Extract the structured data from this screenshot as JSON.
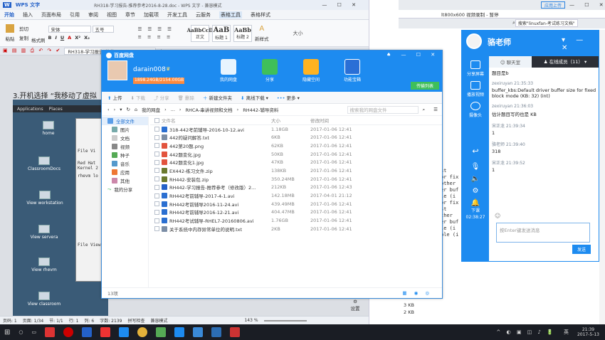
{
  "wps": {
    "app": "WPS 文字",
    "doc_title": "RH318-学习报告-推荐参考2016-8-28.doc - WPS 文字 - 兼容模式",
    "menu": [
      "开始",
      "插入",
      "页面布局",
      "引用",
      "审阅",
      "视图",
      "章节",
      "加载项",
      "开发工具",
      "云服务",
      "表格工具",
      "表格样式"
    ],
    "ribbon": {
      "clipboard": [
        "剪切",
        "复制",
        "格式刷"
      ],
      "paste": "粘贴",
      "font": "宋体",
      "size": "五号",
      "styles": [
        {
          "preview": "AaBbCcD",
          "name": "正文"
        },
        {
          "preview": "AaB",
          "name": "标题 1"
        },
        {
          "preview": "AaBb",
          "name": "标题 2"
        }
      ],
      "new_style": "新样式",
      "big": "大小"
    },
    "tab": "RH318-学习报告-推荐...2016-8-28.doc",
    "doc_line": "3.开机选择 “我移动了虚拟",
    "status": [
      "页码: 1",
      "页面: 1/34",
      "节: 1/1",
      "行: 1",
      "列: 6",
      "字数: 2139",
      "拼写检查",
      "兼容模式"
    ],
    "zoom": "143 %"
  },
  "vm": {
    "bar": [
      "Applications",
      "Places"
    ],
    "icons": [
      "home",
      "ClassroomDocs",
      "View workstation",
      "View servera",
      "View rhevm",
      "View classroom"
    ],
    "term_lines": [
      "File  Vi",
      "Red Hat",
      "Kernel 2",
      "rhevm lo",
      "File  View"
    ]
  },
  "terminal_right": [
    "st",
    "or fix",
    "other",
    "er buf",
    "le (i",
    "or fix",
    "st",
    "ther",
    "er buf",
    "le (i",
    "ble (i"
  ],
  "baidu": {
    "title": "百度网盘",
    "user": "darain008",
    "quota": "1898.24GB/2154.00GB",
    "nav": [
      "我的网盘",
      "分享",
      "隐藏空间",
      "功能宝箱"
    ],
    "transfer": "传输列表",
    "toolbar": [
      "上传",
      "下载",
      "分享",
      "删除",
      "新建文件夹",
      "离线下载",
      "更多"
    ],
    "path": [
      "我的网盘",
      "...",
      "RHCA-串讲视频和文档",
      "RH442-辅导资料"
    ],
    "search_placeholder": "搜索我的网盘文件",
    "side": [
      "全部文件",
      "图片",
      "文档",
      "视频",
      "种子",
      "音乐",
      "应用",
      "其他",
      "我的分享"
    ],
    "cols": [
      "文件名",
      "大小",
      "修改时间"
    ],
    "files": [
      {
        "name": "318-442考前辅导-2016-10-12.avi",
        "size": "1.18GB",
        "time": "2017-01-06 12:41",
        "type": "video"
      },
      {
        "name": "442的疑问解答.txt",
        "size": "6KB",
        "time": "2017-01-06 12:41",
        "type": "txt"
      },
      {
        "name": "442第20题.png",
        "size": "62KB",
        "time": "2017-01-06 12:41",
        "type": "img"
      },
      {
        "name": "442题变化.jpg",
        "size": "50KB",
        "time": "2017-01-06 12:41",
        "type": "img"
      },
      {
        "name": "442题变化1.jpg",
        "size": "47KB",
        "time": "2017-01-06 12:41",
        "type": "img"
      },
      {
        "name": "EX442-练习文件.zip",
        "size": "138KB",
        "time": "2017-01-06 12:41",
        "type": "zip"
      },
      {
        "name": "RH442-安装包.zip",
        "size": "350.24MB",
        "time": "2017-01-06 12:41",
        "type": "zip"
      },
      {
        "name": "RH442-学习报告-推荐参考（修改版）2...",
        "size": "212KB",
        "time": "2017-01-06 12:43",
        "type": "doc"
      },
      {
        "name": "RH442考前辅导-2017-4-1.avi",
        "size": "142.18MB",
        "time": "2017-04-01 21:12",
        "type": "video"
      },
      {
        "name": "RH442考前辅导2016-11-24.avi",
        "size": "439.49MB",
        "time": "2017-01-06 12:41",
        "type": "video"
      },
      {
        "name": "RH442考前辅导2016-12-21.avi",
        "size": "404.47MB",
        "time": "2017-01-06 12:41",
        "type": "video"
      },
      {
        "name": "RH442考试辅导-RHEL7-20160806.avi",
        "size": "1.76GB",
        "time": "2017-01-06 12:41",
        "type": "video"
      },
      {
        "name": "关于系统中内存异常单位的说明.txt",
        "size": "2KB",
        "time": "2017-01-06 12:41",
        "type": "txt"
      }
    ],
    "count": "13项"
  },
  "browser": {
    "address": "lt800x600  视频录制 - 暂停",
    "tab": "搜索\"linuxfan-考试练习文档\"",
    "button": "应用上传"
  },
  "chat": {
    "name": "骆老师",
    "tabs": [
      "聊天室",
      "在线成员（11）"
    ],
    "side": [
      "分享屏幕",
      "播放视频",
      "摄像头",
      "下课"
    ],
    "time": "02:38:27",
    "messages": [
      {
        "who": "",
        "text": "题目是b"
      },
      {
        "who": "zexiruyan 21:35:33",
        "text": "buffer_kbs:Default driver buffer size for fixed block mode (KB: 32) (int)"
      },
      {
        "who": "zexiruyan 21:36:03",
        "text": "估计题目写的也是 KB"
      },
      {
        "who": "宋正龙 21:39:34",
        "text": "1"
      },
      {
        "who": "骆老师 21:39:40",
        "text": "318"
      },
      {
        "who": "宋正龙 21:39:52",
        "text": "1"
      }
    ],
    "input_placeholder": "按Enter键发送消息",
    "send": "发送"
  },
  "mid": {
    "sizes": [
      "3 KB",
      "2 KB"
    ],
    "settings": "设置"
  },
  "taskbar": {
    "time": "21:39",
    "date": "2017-5-13",
    "ime": "英"
  },
  "colors": {
    "accent": "#1d8bf0",
    "wps": "#2461c8"
  }
}
